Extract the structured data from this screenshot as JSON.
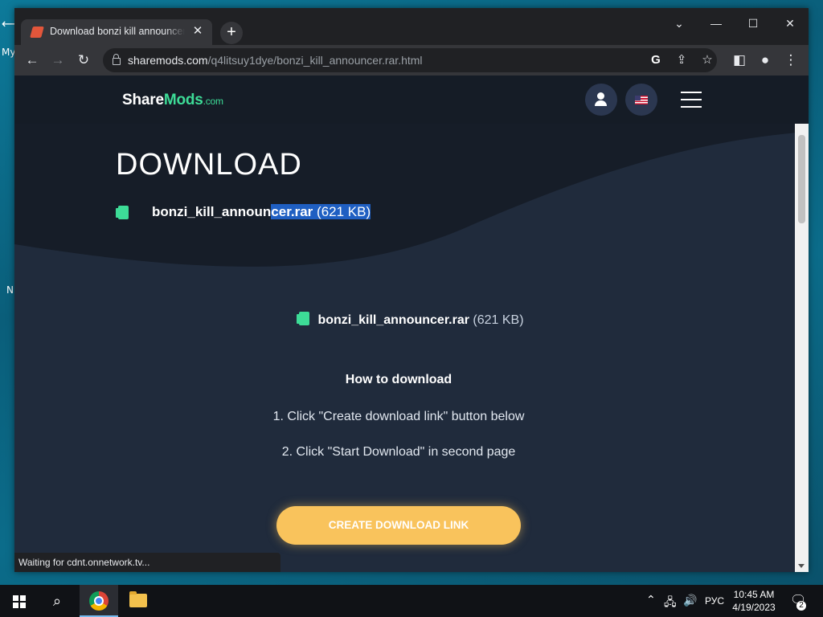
{
  "desktop": {
    "labels": [
      "My",
      "N"
    ]
  },
  "tab": {
    "title": "Download bonzi kill announcer.rar",
    "close_icon": "close-icon",
    "new_tab_label": "+"
  },
  "window": {
    "minimize": "—",
    "maximize": "☐",
    "close": "✕",
    "tab_search": "⌄"
  },
  "toolbar": {
    "back": "←",
    "forward": "→",
    "reload": "↻",
    "url_host": "sharemods.com",
    "url_path": "/q4litsuy1dye/bonzi_kill_announcer.rar.html"
  },
  "site": {
    "logo_share": "Share",
    "logo_mods": "Mods",
    "logo_tld": ".com",
    "heading": "DOWNLOAD",
    "file_name_part1": "bonzi_kill_announ",
    "file_name_part2": "cer.rar",
    "file_size": "(621 KB)",
    "file_name": "bonzi_kill_announcer.rar",
    "how_to_title": "How to download",
    "step1": "1. Click \"Create download link\" button below",
    "step2": "2. Click \"Start Download\" in second page",
    "cta_label": "CREATE DOWNLOAD LINK"
  },
  "status": {
    "text": "Waiting for cdnt.onnetwork.tv..."
  },
  "taskbar": {
    "language": "РУС",
    "time": "10:45 AM",
    "date": "4/19/2023",
    "notification_count": "2"
  },
  "colors": {
    "accent_green": "#3ddc97",
    "cta_yellow": "#f9c35c",
    "page_bg": "#202b3c",
    "selection_blue": "#1f5fc2"
  }
}
